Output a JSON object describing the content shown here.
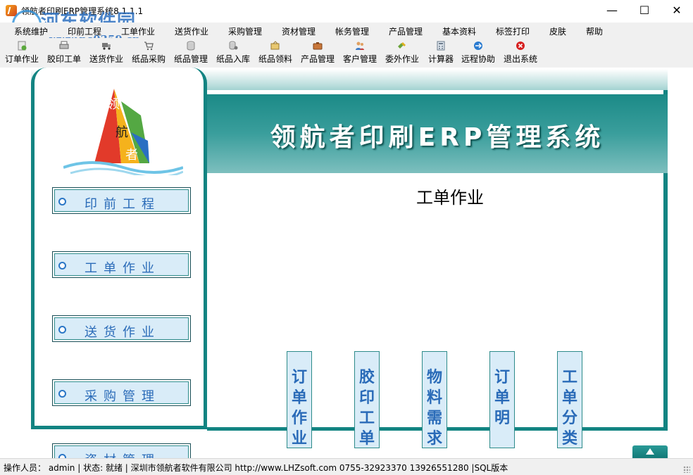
{
  "window": {
    "title": "领航者印刷ERP管理系统8.1.1.1",
    "minimize": "—",
    "maximize": "☐",
    "close": "✕"
  },
  "watermark": {
    "site": "河东软件园",
    "url": "www.pc0359.cn"
  },
  "menu": [
    "系统维护",
    "印前工程",
    "工单作业",
    "送货作业",
    "采购管理",
    "资材管理",
    "帐务管理",
    "产品管理",
    "基本资料",
    "标签打印",
    "皮肤",
    "帮助"
  ],
  "toolbar": [
    {
      "label": "订单作业",
      "icon": "order-icon",
      "color": "#5aa83c"
    },
    {
      "label": "胶印工单",
      "icon": "print-icon",
      "color": "#7a7a7a"
    },
    {
      "label": "送货作业",
      "icon": "truck-icon",
      "color": "#666666"
    },
    {
      "label": "纸品采购",
      "icon": "cart-icon",
      "color": "#7a7a7a"
    },
    {
      "label": "纸品管理",
      "icon": "paper-icon",
      "color": "#9a9a9a"
    },
    {
      "label": "纸品入库",
      "icon": "warehouse-in-icon",
      "color": "#8a8a8a"
    },
    {
      "label": "纸品领料",
      "icon": "material-out-icon",
      "color": "#c09a40"
    },
    {
      "label": "产品管理",
      "icon": "product-icon",
      "color": "#b5652a"
    },
    {
      "label": "客户管理",
      "icon": "customer-icon",
      "color": "#3d7bc6"
    },
    {
      "label": "委外作业",
      "icon": "outsource-icon",
      "color": "#6aa33a"
    },
    {
      "label": "计算器",
      "icon": "calculator-icon",
      "color": "#6a7a8a"
    },
    {
      "label": "远程协助",
      "icon": "remote-icon",
      "color": "#2a7bd0"
    },
    {
      "label": "退出系统",
      "icon": "exit-icon",
      "color": "#d62020"
    }
  ],
  "logo": {
    "chars": [
      "领",
      "航",
      "者"
    ]
  },
  "nav": [
    {
      "label": "印前工程"
    },
    {
      "label": "工单作业"
    },
    {
      "label": "送货作业"
    },
    {
      "label": "采购管理"
    },
    {
      "label": "资材管理"
    }
  ],
  "banner": {
    "title": "领航者印刷ERP管理系统"
  },
  "content": {
    "title": "工单作业",
    "vertical_buttons": [
      "订单作业系",
      "胶印工单",
      "物料需求",
      "订单明",
      "工单分类"
    ]
  },
  "status": {
    "text": "操作人员：  admin  |  状态: 就绪 |  深圳市领航者软件有限公司 http://www.LHZsoft.com   0755-32923370  13926551280  |SQL版本"
  }
}
